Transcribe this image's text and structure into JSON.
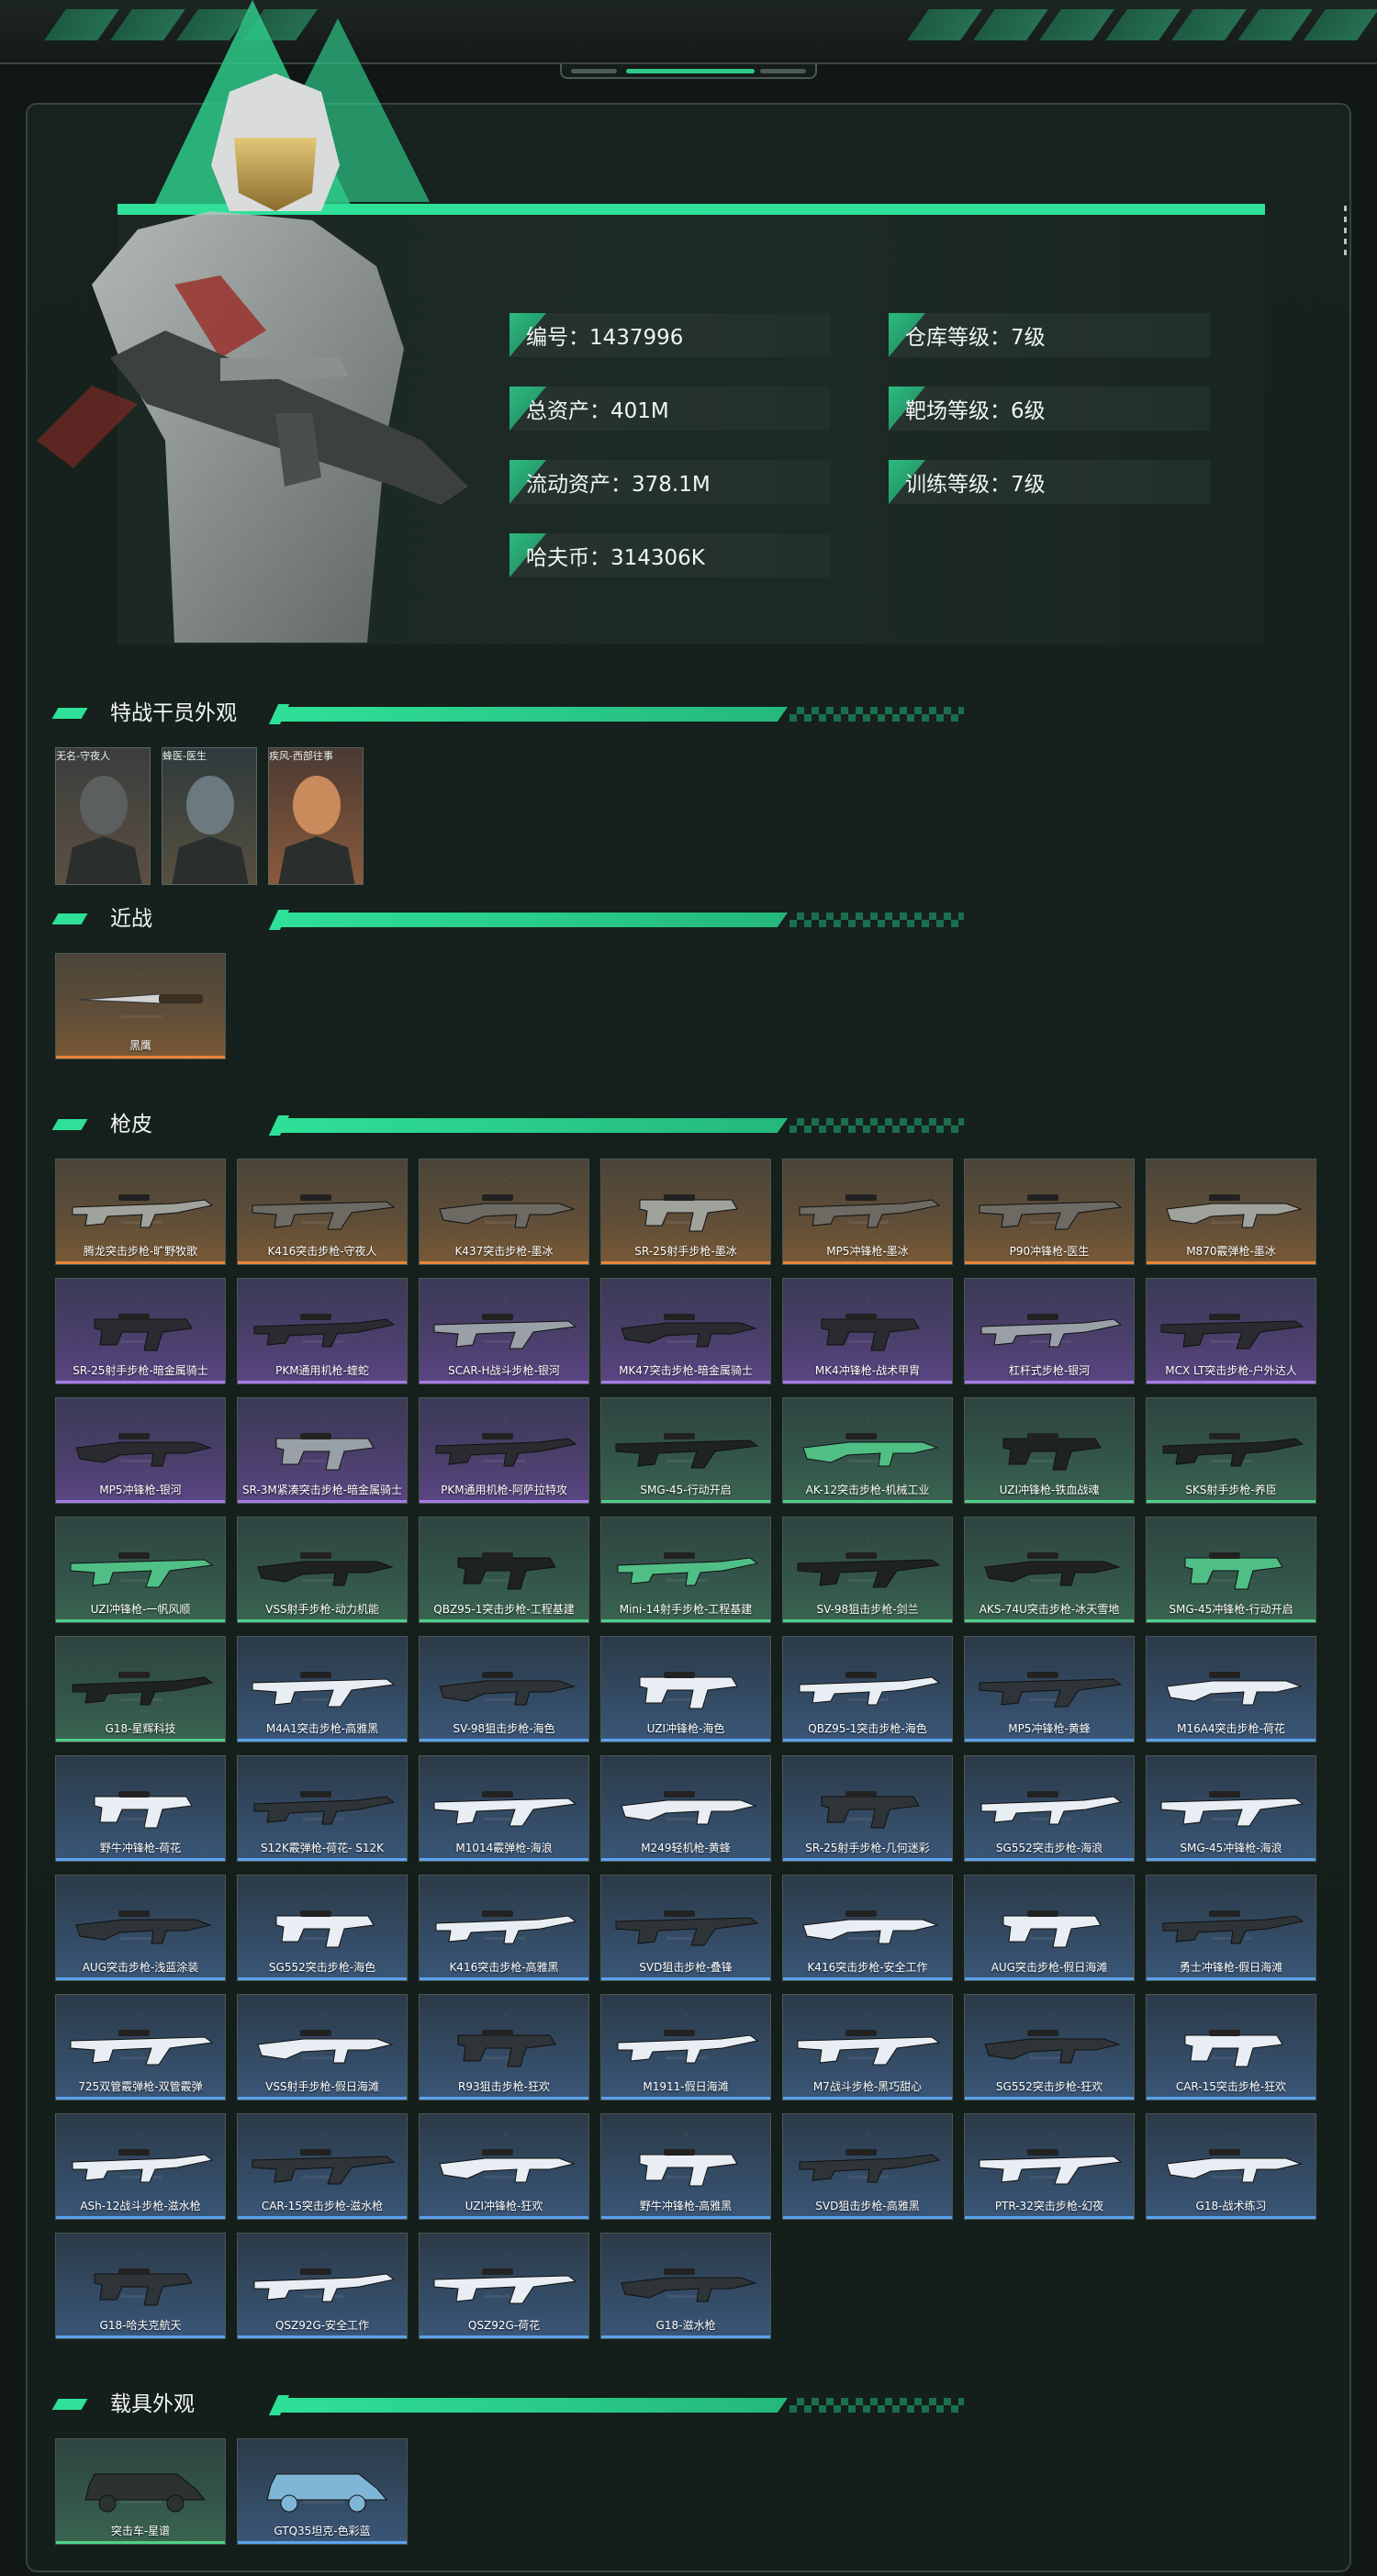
{
  "hero": {
    "stats": [
      {
        "label": "编号：1437996"
      },
      {
        "label": "仓库等级：7级"
      },
      {
        "label": "总资产：401M"
      },
      {
        "label": "靶场等级：6级"
      },
      {
        "label": "流动资产：378.1M"
      },
      {
        "label": "训练等级：7级"
      },
      {
        "label": "哈夫币：314306K"
      }
    ]
  },
  "sections": {
    "operators": "特战干员外观",
    "melee": "近战",
    "skins": "枪皮",
    "vehicles": "载具外观"
  },
  "operators": [
    {
      "name": "无名-守夜人"
    },
    {
      "name": "蜂医-医生"
    },
    {
      "name": "疾风-西部往事"
    }
  ],
  "melee": [
    {
      "name": "黑鹰",
      "rarity": "orange"
    }
  ],
  "skins": [
    {
      "name": "腾龙突击步枪-旷野牧歌",
      "rarity": "orange"
    },
    {
      "name": "K416突击步枪-守夜人",
      "rarity": "orange"
    },
    {
      "name": "K437突击步枪-墨冰",
      "rarity": "orange"
    },
    {
      "name": "SR-25射手步枪-墨冰",
      "rarity": "orange"
    },
    {
      "name": "MP5冲锋枪-墨冰",
      "rarity": "orange"
    },
    {
      "name": "P90冲锋枪-医生",
      "rarity": "orange"
    },
    {
      "name": "M870霰弹枪-墨冰",
      "rarity": "orange"
    },
    {
      "name": "SR-25射手步枪-暗金属骑士",
      "rarity": "purple"
    },
    {
      "name": "PKM通用机枪-蝰蛇",
      "rarity": "purple"
    },
    {
      "name": "SCAR-H战斗步枪-银河",
      "rarity": "purple"
    },
    {
      "name": "MK47突击步枪-暗金属骑士",
      "rarity": "purple"
    },
    {
      "name": "MK4冲锋枪-战术甲胄",
      "rarity": "purple"
    },
    {
      "name": "杠杆式步枪-银河",
      "rarity": "purple"
    },
    {
      "name": "MCX LT突击步枪-户外达人",
      "rarity": "purple"
    },
    {
      "name": "MP5冲锋枪-银河",
      "rarity": "purple"
    },
    {
      "name": "SR-3M紧凑突击步枪-暗金属骑士",
      "rarity": "purple"
    },
    {
      "name": "PKM通用机枪-阿萨拉特攻",
      "rarity": "purple"
    },
    {
      "name": "SMG-45-行动开启",
      "rarity": "green"
    },
    {
      "name": "AK-12突击步枪-机械工业",
      "rarity": "green"
    },
    {
      "name": "UZI冲锋枪-铁血战魂",
      "rarity": "green"
    },
    {
      "name": "SKS射手步枪-养臣",
      "rarity": "green"
    },
    {
      "name": "UZI冲锋枪-一帆风顺",
      "rarity": "green"
    },
    {
      "name": "VSS射手步枪-动力机能",
      "rarity": "green"
    },
    {
      "name": "QBZ95-1突击步枪-工程基建",
      "rarity": "green"
    },
    {
      "name": "Mini-14射手步枪-工程基建",
      "rarity": "green"
    },
    {
      "name": "SV-98狙击步枪-剑兰",
      "rarity": "green"
    },
    {
      "name": "AKS-74U突击步枪-冰天雪地",
      "rarity": "green"
    },
    {
      "name": "SMG-45冲锋枪-行动开启",
      "rarity": "green"
    },
    {
      "name": "G18-星辉科技",
      "rarity": "green"
    },
    {
      "name": "M4A1突击步枪-高雅黑",
      "rarity": "blue"
    },
    {
      "name": "SV-98狙击步枪-海色",
      "rarity": "blue"
    },
    {
      "name": "UZI冲锋枪-海色",
      "rarity": "blue"
    },
    {
      "name": "QBZ95-1突击步枪-海色",
      "rarity": "blue"
    },
    {
      "name": "MP5冲锋枪-黄蜂",
      "rarity": "blue"
    },
    {
      "name": "M16A4突击步枪-荷花",
      "rarity": "blue"
    },
    {
      "name": "野牛冲锋枪-荷花",
      "rarity": "blue"
    },
    {
      "name": "S12K霰弹枪-荷花- S12K",
      "rarity": "blue"
    },
    {
      "name": "M1014霰弹枪-海浪",
      "rarity": "blue"
    },
    {
      "name": "M249轻机枪-黄蜂",
      "rarity": "blue"
    },
    {
      "name": "SR-25射手步枪-几何迷彩",
      "rarity": "blue"
    },
    {
      "name": "SG552突击步枪-海浪",
      "rarity": "blue"
    },
    {
      "name": "SMG-45冲锋枪-海浪",
      "rarity": "blue"
    },
    {
      "name": "AUG突击步枪-浅蓝涂装",
      "rarity": "blue"
    },
    {
      "name": "SG552突击步枪-海色",
      "rarity": "blue"
    },
    {
      "name": "K416突击步枪-高雅黑",
      "rarity": "blue"
    },
    {
      "name": "SVD狙击步枪-叠锋",
      "rarity": "blue"
    },
    {
      "name": "K416突击步枪-安全工作",
      "rarity": "blue"
    },
    {
      "name": "AUG突击步枪-假日海滩",
      "rarity": "blue"
    },
    {
      "name": "勇士冲锋枪-假日海滩",
      "rarity": "blue"
    },
    {
      "name": "725双管霰弹枪-双管霰弹",
      "rarity": "blue"
    },
    {
      "name": "VSS射手步枪-假日海滩",
      "rarity": "blue"
    },
    {
      "name": "R93狙击步枪-狂欢",
      "rarity": "blue"
    },
    {
      "name": "M1911-假日海滩",
      "rarity": "blue"
    },
    {
      "name": "M7战斗步枪-黑巧甜心",
      "rarity": "blue"
    },
    {
      "name": "SG552突击步枪-狂欢",
      "rarity": "blue"
    },
    {
      "name": "CAR-15突击步枪-狂欢",
      "rarity": "blue"
    },
    {
      "name": "ASh-12战斗步枪-滋水枪",
      "rarity": "blue"
    },
    {
      "name": "CAR-15突击步枪-滋水枪",
      "rarity": "blue"
    },
    {
      "name": "UZI冲锋枪-狂欢",
      "rarity": "blue"
    },
    {
      "name": "野牛冲锋枪-高雅黑",
      "rarity": "blue"
    },
    {
      "name": "SVD狙击步枪-高雅黑",
      "rarity": "blue"
    },
    {
      "name": "PTR-32突击步枪-幻夜",
      "rarity": "blue"
    },
    {
      "name": "G18-战术练习",
      "rarity": "blue"
    },
    {
      "name": "G18-哈夫克航天",
      "rarity": "blue"
    },
    {
      "name": "QSZ92G-安全工作",
      "rarity": "blue"
    },
    {
      "name": "QSZ92G-荷花",
      "rarity": "blue"
    },
    {
      "name": "G18-滋水枪",
      "rarity": "blue"
    }
  ],
  "vehicles": [
    {
      "name": "突击车-星谱",
      "rarity": "green"
    },
    {
      "name": "GTQ35坦克-色彩蓝",
      "rarity": "blue"
    }
  ]
}
